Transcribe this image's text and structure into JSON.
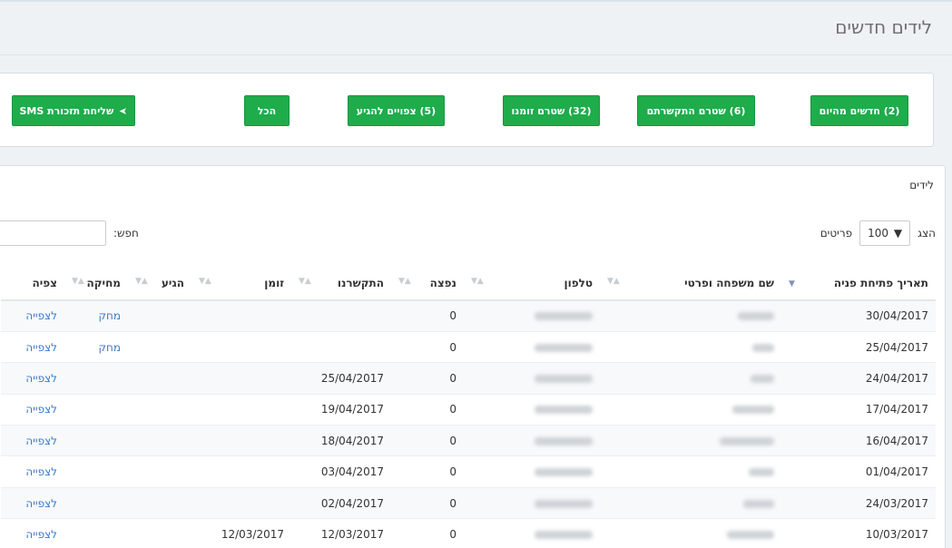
{
  "page": {
    "title": "לידים חדשים"
  },
  "filters": [
    {
      "label": "(2) חדשים מהיום"
    },
    {
      "label": "(6) שטרם התקשרתם"
    },
    {
      "label": "(32) שטרם זומנו"
    },
    {
      "label": "(5) צפויים להגיע"
    },
    {
      "label": "הכל"
    },
    {
      "label": "שליחת תזכורת SMS",
      "icon": "paper-plane-icon"
    }
  ],
  "leads": {
    "heading": "לידים",
    "length_prefix": "הצג",
    "length_value": "100",
    "length_suffix": "פריטים",
    "search_label": "חפש:",
    "columns": [
      "תאריך פתיחת פניה",
      "שם משפחה ופרטי",
      "טלפון",
      "נפצה",
      "התקשרנו",
      "זומן",
      "הגיע",
      "מחיקה",
      "צפיה"
    ],
    "rows": [
      {
        "date": "30/04/2017",
        "missed": "0",
        "called": "",
        "scheduled": "",
        "arrived": "",
        "delete": "מחק",
        "view": "לצפייה"
      },
      {
        "date": "25/04/2017",
        "missed": "0",
        "called": "",
        "scheduled": "",
        "arrived": "",
        "delete": "מחק",
        "view": "לצפייה"
      },
      {
        "date": "24/04/2017",
        "missed": "0",
        "called": "25/04/2017",
        "scheduled": "",
        "arrived": "",
        "delete": "",
        "view": "לצפייה"
      },
      {
        "date": "17/04/2017",
        "missed": "0",
        "called": "19/04/2017",
        "scheduled": "",
        "arrived": "",
        "delete": "",
        "view": "לצפייה"
      },
      {
        "date": "16/04/2017",
        "missed": "0",
        "called": "18/04/2017",
        "scheduled": "",
        "arrived": "",
        "delete": "",
        "view": "לצפייה"
      },
      {
        "date": "01/04/2017",
        "missed": "0",
        "called": "03/04/2017",
        "scheduled": "",
        "arrived": "",
        "delete": "",
        "view": "לצפייה"
      },
      {
        "date": "24/03/2017",
        "missed": "0",
        "called": "02/04/2017",
        "scheduled": "",
        "arrived": "",
        "delete": "",
        "view": "לצפייה"
      },
      {
        "date": "10/03/2017",
        "missed": "0",
        "called": "12/03/2017",
        "scheduled": "12/03/2017",
        "arrived": "",
        "delete": "",
        "view": "לצפייה"
      }
    ]
  }
}
